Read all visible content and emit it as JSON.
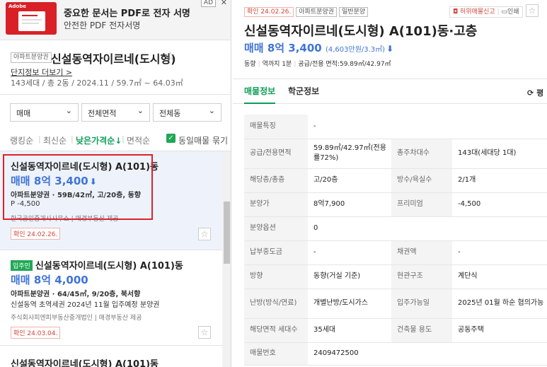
{
  "ad": {
    "brand": "Adobe",
    "badge": "AD",
    "close": "✕",
    "title": "중요한 문서는 PDF로 전자 서명",
    "subtitle": "안전한 PDF 전자서명"
  },
  "complex": {
    "tag": "아파트분양권",
    "name": "신설동역자이르네(도시형)",
    "info_link": "단지정보 더보기 >",
    "summary": "143세대 / 총 2동 / 2024.11 / 59.7㎡ ~ 64.03㎡"
  },
  "filters": [
    {
      "label": "매매"
    },
    {
      "label": "전체면적"
    },
    {
      "label": "전체동"
    }
  ],
  "sorts": {
    "ranking": "랭킹순",
    "latest": "최신순",
    "low_price": "낮은가격순↓",
    "area": "면적순",
    "same_listing": "동일매물 묶기"
  },
  "listings": [
    {
      "name": "신설동역자이르네(도시형) A(101)동",
      "price": "매매 8억 3,400",
      "detail": "아파트분양권 · 59B/42㎡, 고/20층, 동향",
      "extra": "P -4,500",
      "agent": "한국공인중개사사무소 | 매경부동산 제공",
      "confirm": "확인 24.02.26."
    },
    {
      "badge": "입주민",
      "name": "신설동역자이르네(도시형) A(101)동",
      "price": "매매 8억 4,000",
      "detail": "아파트분양권 · 64/45㎡, 9/20층, 북서향",
      "extra": "신설동역 초역세권 2024년 11월 입주예정 분양권",
      "agent": "주식회사피엔피부동산중개법인 | 매경부동산 제공",
      "confirm": "확인 24.03.04."
    },
    {
      "name": "신설동역자이르네(도시형) A(101)동"
    }
  ],
  "detail": {
    "confirm": "확인 24.02.26.",
    "tags": [
      "아파트분양권",
      "일반분양"
    ],
    "report": "허위매물신고",
    "print": "인쇄",
    "title": "신설동역자이르네(도시형) A(101)동·고층",
    "price": "매매 8억 3,400",
    "price_sub": "(4,603만원/3.3㎡)",
    "info": [
      "동향",
      "역까지 1분",
      "공급/전용 면적:59.89㎡/42.97㎡"
    ],
    "tabs": [
      "매물정보",
      "학군정보"
    ],
    "refresh": "평",
    "rows": [
      {
        "k1": "매물특징",
        "v1": "-",
        "k2": "",
        "v2": ""
      },
      {
        "k1": "공급/전용면적",
        "v1": "59.89㎡/42.97㎡(전용률72%)",
        "k2": "총주차대수",
        "v2": "143대(세대당 1대)"
      },
      {
        "k1": "해당층/총층",
        "v1": "고/20층",
        "k2": "방수/욕실수",
        "v2": "2/1개"
      },
      {
        "k1": "분양가",
        "v1": "8억7,900",
        "k2": "프리미엄",
        "v2": "-4,500"
      },
      {
        "k1": "분양옵션",
        "v1": "0",
        "k2": "",
        "v2": ""
      },
      {
        "k1": "납부중도금",
        "v1": "-",
        "k2": "채권액",
        "v2": "-"
      },
      {
        "k1": "방향",
        "v1": "동향(거실 기준)",
        "k2": "현관구조",
        "v2": "계단식"
      },
      {
        "k1": "난방(방식/연료)",
        "v1": "개별난방/도시가스",
        "k2": "입주가능일",
        "v2": "2025년 01월 하순 협의가능"
      },
      {
        "k1": "해당면적 세대수",
        "v1": "35세대",
        "k2": "건축물 용도",
        "v2": "공동주택"
      },
      {
        "k1": "매물번호",
        "v1": "2409472500",
        "k2": "",
        "v2": ""
      }
    ]
  },
  "colors": {
    "price_blue": "#3f74d6",
    "accent_green": "#0e9d58",
    "confirm_red": "#d4453a",
    "highlight_red": "#e0202a"
  }
}
